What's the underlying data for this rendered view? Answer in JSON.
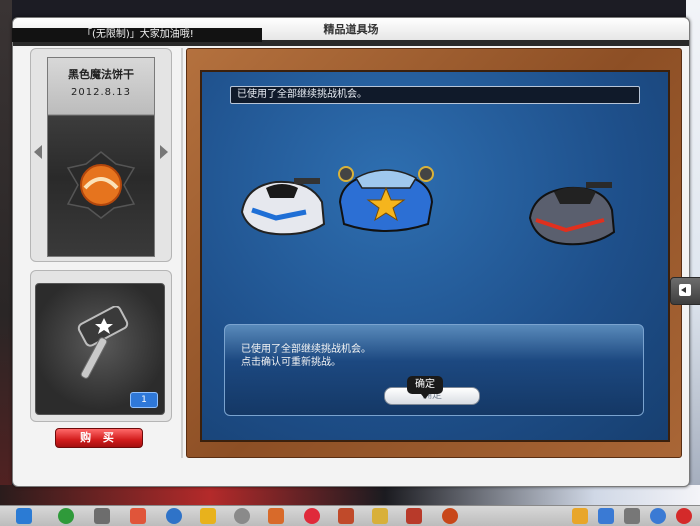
{
  "window": {
    "title": "精品道具场"
  },
  "ticker": {
    "text": "「(无限制)」大家加油哦!"
  },
  "item": {
    "name": "黑色魔法饼干",
    "date": "2012.8.13"
  },
  "gift": {
    "quantity": "1"
  },
  "buy_button": {
    "label": "购  买"
  },
  "board": {
    "message": "已使用了全部继续挑战机会。"
  },
  "popup": {
    "line1": "已使用了全部继续挑战机会。",
    "line2": "点击确认可重新挑战。",
    "ok_label": "确定",
    "tooltip": "确定"
  },
  "colors": {
    "accent": "#1e4f8a",
    "buy": "#d21c1c",
    "frame": "#8d4f25"
  },
  "taskbar_icons": [
    "app-menu-icon",
    "back-icon",
    "shop-cart-icon",
    "character-icon",
    "swirl-icon",
    "gold-item-icon",
    "gear-icon",
    "chat-icon",
    "heart-icon",
    "brush-icon",
    "tools-icon",
    "book-icon",
    "face-icon",
    "notes-icon",
    "settings-icon",
    "wrench-icon",
    "search-icon",
    "power-icon"
  ]
}
